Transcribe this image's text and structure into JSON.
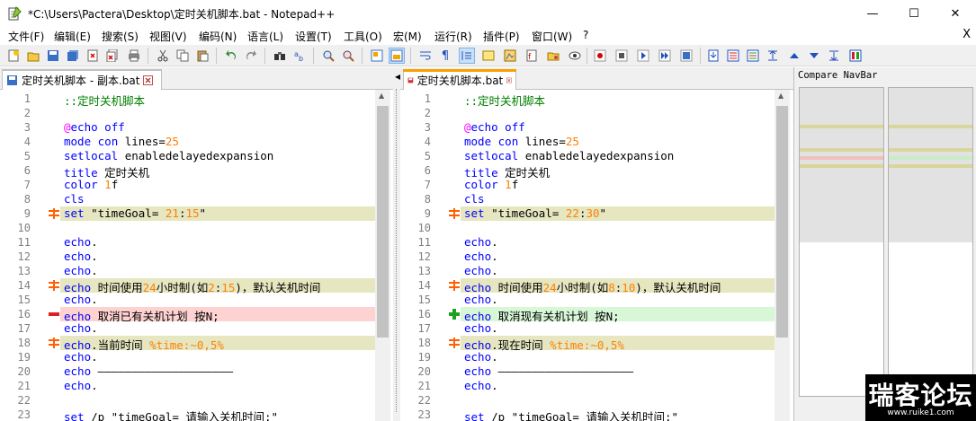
{
  "window": {
    "title": "*C:\\Users\\Pactera\\Desktop\\定时关机脚本.bat - Notepad++",
    "minimize": "—",
    "maximize": "☐",
    "close": "✕"
  },
  "menu": {
    "items": [
      "文件(F)",
      "编辑(E)",
      "搜索(S)",
      "视图(V)",
      "编码(N)",
      "语言(L)",
      "设置(T)",
      "工具(O)",
      "宏(M)",
      "运行(R)",
      "插件(P)",
      "窗口(W)",
      "?"
    ],
    "close": "X"
  },
  "left_pane": {
    "tab_label": "定时关机脚本 - 副本.bat",
    "lines": [
      {
        "n": "1",
        "t": "::定时关机脚本"
      },
      {
        "n": "2",
        "t": ""
      },
      {
        "n": "3",
        "t": "@echo off"
      },
      {
        "n": "4",
        "t": "mode con lines=25"
      },
      {
        "n": "5",
        "t": "setlocal enabledelayedexpansion"
      },
      {
        "n": "6",
        "t": "title 定时关机"
      },
      {
        "n": "7",
        "t": "color 1f"
      },
      {
        "n": "8",
        "t": "cls"
      },
      {
        "n": "9",
        "t": "set \"timeGoal= 21:15\""
      },
      {
        "n": "10",
        "t": ""
      },
      {
        "n": "11",
        "t": "echo."
      },
      {
        "n": "12",
        "t": "echo."
      },
      {
        "n": "13",
        "t": "echo."
      },
      {
        "n": "14",
        "t": "echo 时间使用24小时制(如2:15)，默认关机时间"
      },
      {
        "n": "15",
        "t": "echo."
      },
      {
        "n": "16",
        "t": "echo 取消已有关机计划 按N;"
      },
      {
        "n": "17",
        "t": "echo."
      },
      {
        "n": "18",
        "t": "echo.当前时间 %time:~0,5%"
      },
      {
        "n": "19",
        "t": "echo."
      },
      {
        "n": "20",
        "t": "echo ————————————————————"
      },
      {
        "n": "21",
        "t": "echo."
      },
      {
        "n": "22",
        "t": ""
      },
      {
        "n": "23",
        "t": "set /p \"timeGoal= 请输入关机时间:\""
      }
    ]
  },
  "right_pane": {
    "tab_label": "定时关机脚本.bat",
    "lines": [
      {
        "n": "1",
        "t": "::定时关机脚本"
      },
      {
        "n": "2",
        "t": ""
      },
      {
        "n": "3",
        "t": "@echo off"
      },
      {
        "n": "4",
        "t": "mode con lines=25"
      },
      {
        "n": "5",
        "t": "setlocal enabledelayedexpansion"
      },
      {
        "n": "6",
        "t": "title 定时关机"
      },
      {
        "n": "7",
        "t": "color 1f"
      },
      {
        "n": "8",
        "t": "cls"
      },
      {
        "n": "9",
        "t": "set \"timeGoal= 22:30\""
      },
      {
        "n": "10",
        "t": ""
      },
      {
        "n": "11",
        "t": "echo."
      },
      {
        "n": "12",
        "t": "echo."
      },
      {
        "n": "13",
        "t": "echo."
      },
      {
        "n": "14",
        "t": "echo 时间使用24小时制(如8:10)，默认关机时间"
      },
      {
        "n": "15",
        "t": "echo."
      },
      {
        "n": "16",
        "t": "echo 取消现有关机计划 按N;"
      },
      {
        "n": "17",
        "t": "echo."
      },
      {
        "n": "18",
        "t": "echo.现在时间 %time:~0,5%"
      },
      {
        "n": "19",
        "t": "echo."
      },
      {
        "n": "20",
        "t": "echo ————————————————————"
      },
      {
        "n": "21",
        "t": "echo."
      },
      {
        "n": "22",
        "t": ""
      },
      {
        "n": "23",
        "t": "set /p \"timeGoal= 请输入关机时间:\""
      }
    ]
  },
  "navbar": {
    "title": "Compare NavBar"
  },
  "watermark": {
    "text": "瑞客论坛",
    "sub": "www.ruike1.com"
  },
  "colors": {
    "changed": "#e6e6c0",
    "removed": "#ffd2d2",
    "added": "#d7f7d7",
    "changed_marker": "#ff6000",
    "removed_marker": "#e02020",
    "added_marker": "#20a020"
  }
}
